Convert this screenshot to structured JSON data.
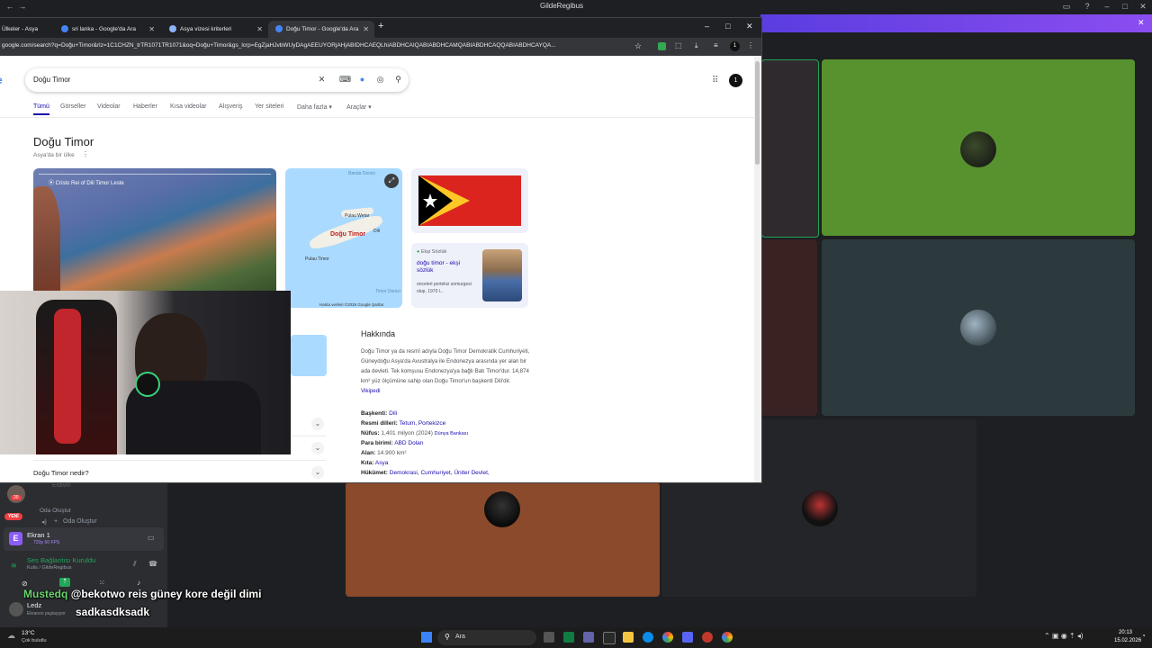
{
  "discord": {
    "window_title": "GildeRegibus",
    "sidebar": {
      "user_badge": "20",
      "voice_item_ghost": "Eldivin",
      "category_label": "Oda Oluştur",
      "create_room": "Oda Oluştur",
      "new_badge": "YENİ",
      "screen_share_title": "Ekran 1",
      "screen_share_sub": "720p 60 FPS",
      "voice_connected": "Ses Bağlantısı Kuruldu",
      "voice_channel": "Kulis / GildeRegibus",
      "user_name": "Ledz",
      "user_status": "Ekranını paylaşıyor"
    },
    "accent": "#5865f2"
  },
  "chrome": {
    "tabs": [
      {
        "label": "Ülkeler - Asya"
      },
      {
        "label": "sri lanka - Google'da Ara"
      },
      {
        "label": "Asya vizesi kriterleri"
      },
      {
        "label": "Doğu Timor - Google'da Ara"
      }
    ],
    "new_tab": "+",
    "url": "google.com/search?q=Doğu+Timor&rlz=1C1CHZN_trTR1071TR1071&oq=Doğu+Timor&gs_lcrp=EgZjaHJvbWUyDAgAEEUYORjAHjABIDHCAEQLhiABDHCAIQABIABDHCAMQABIABDHCAQQABIABDHCAYQA...",
    "profile_initial": "1"
  },
  "google": {
    "query": "Doğu Timor",
    "nav_tabs": [
      "Tümü",
      "Görseller",
      "Videolar",
      "Haberler",
      "Kısa videolar",
      "Alışveriş",
      "Yer siteleri",
      "Daha fazla",
      "Araçlar"
    ],
    "kp_title": "Doğu Timor",
    "kp_subtitle": "Asya'da bir ülke",
    "photo_caption": "Cristo Rei of Dili Timor Leste",
    "map_labels": {
      "sea": "Banda Denizi",
      "island1": "Pulau Wetar",
      "country": "Doğu Timor",
      "city": "Dili",
      "island2": "Pulau Timor",
      "sea2": "Timor Denizi",
      "credit": "Harita verileri ©2026 Google",
      "terms": "Şartlar"
    },
    "eksi": {
      "source": "Ekşi Sözlük",
      "title": "doğu timor - ekşi sözlük",
      "snippet": "onceleri portekiz somurgesi olup, 1970 l..."
    },
    "about_title": "Hakkında",
    "about_text": "Doğu Timor ya da resmî adıyla Doğu Timor Demokratik Cumhuriyeti, Güneydoğu Asya'da Avustralya ile Endonezya arasında yer alan bir ada devleti. Tek komşusu Endonezya'ya bağlı Batı Timor'dur. 14,874 km² yüz ölçümüne sahip olan Doğu Timor'un başkenti Dili'dir.",
    "about_link": "Vikipedi",
    "facts": [
      {
        "key": "Başkenti:",
        "value": "Dili",
        "extra": ""
      },
      {
        "key": "Resmi dilleri:",
        "value": "Tetum, Portekizce",
        "extra": ""
      },
      {
        "key": "Nüfus:",
        "value": "1,401 milyon (2024)",
        "extra": "Dünya Bankası"
      },
      {
        "key": "Para birimi:",
        "value": "ABD Doları",
        "extra": ""
      },
      {
        "key": "Alan:",
        "value": "14.900 km²",
        "extra": ""
      },
      {
        "key": "Kıta:",
        "value": "Asya",
        "extra": ""
      },
      {
        "key": "Hükümet:",
        "value": "Demokrasi, Cumhuriyet, Üniter Devlet,",
        "extra": ""
      }
    ],
    "paa_question": "Doğu Timor nedir?"
  },
  "stream_chat": {
    "user1": "Mustedq",
    "msg1": "@bekotwo reis güney kore değil dimi",
    "msg2": "sadkasdksadk"
  },
  "taskbar": {
    "weather_temp": "13°C",
    "weather_desc": "Çok bulutlu",
    "search": "Ara",
    "time": "20:13",
    "date": "15.02.2026"
  }
}
